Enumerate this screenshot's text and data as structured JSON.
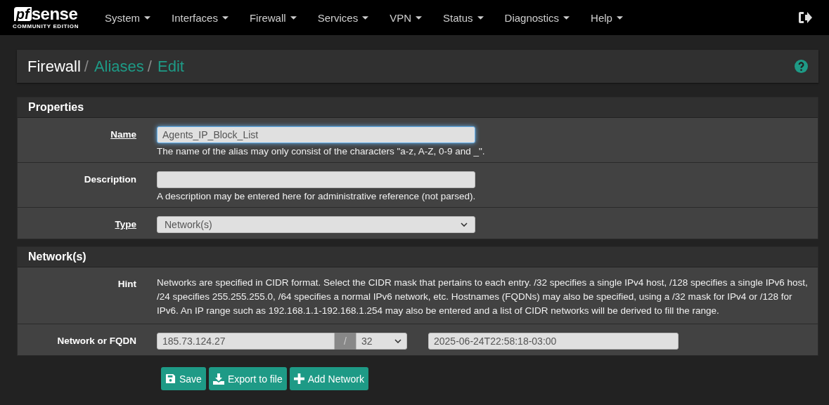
{
  "navbar": {
    "logo": {
      "word_a": "pf",
      "word_b": "sense",
      "edition": "COMMUNITY EDITION"
    },
    "menus": [
      {
        "label": "System"
      },
      {
        "label": "Interfaces"
      },
      {
        "label": "Firewall"
      },
      {
        "label": "Services"
      },
      {
        "label": "VPN"
      },
      {
        "label": "Status"
      },
      {
        "label": "Diagnostics"
      },
      {
        "label": "Help"
      }
    ]
  },
  "breadcrumb": [
    {
      "label": "Firewall",
      "kind": "text",
      "separator": "/"
    },
    {
      "label": "Aliases",
      "kind": "link",
      "separator": "/"
    },
    {
      "label": "Edit",
      "kind": "link"
    }
  ],
  "panels": [
    {
      "title": "Properties",
      "rows": [
        {
          "kind": "text",
          "label": "Name",
          "required": true,
          "value": "Agents_IP_Block_List",
          "focused": true,
          "help": "The name of the alias may only consist of the characters \"a-z, A-Z, 0-9 and _\"."
        },
        {
          "kind": "text",
          "label": "Description",
          "required": false,
          "value": "",
          "focused": false,
          "help": "A description may be entered here for administrative reference (not parsed)."
        },
        {
          "kind": "select",
          "label": "Type",
          "required": true,
          "value": "Network(s)"
        }
      ]
    },
    {
      "title": "Network(s)",
      "rows": [
        {
          "kind": "hint",
          "label": "Hint",
          "text": "Networks are specified in CIDR format. Select the CIDR mask that pertains to each entry. /32 specifies a single IPv4 host, /128 specifies a single IPv6 host, /24 specifies 255.255.255.0, /64 specifies a normal IPv6 network, etc. Hostnames (FQDNs) may also be specified, using a /32 mask for IPv4 or /128 for IPv6. An IP range such as 192.168.1.1-192.168.1.254 may also be entered and a list of CIDR networks will be derived to fill the range."
        },
        {
          "kind": "network",
          "label": "Network or FQDN",
          "required": false,
          "address": "185.73.124.27",
          "separator": "/",
          "mask": "32",
          "description": "2025-06-24T22:58:18-03:00"
        }
      ]
    }
  ],
  "buttons": [
    {
      "label": "Save",
      "kind": "save"
    },
    {
      "label": "Export to file",
      "kind": "export"
    },
    {
      "label": "Add Network",
      "kind": "add"
    }
  ]
}
